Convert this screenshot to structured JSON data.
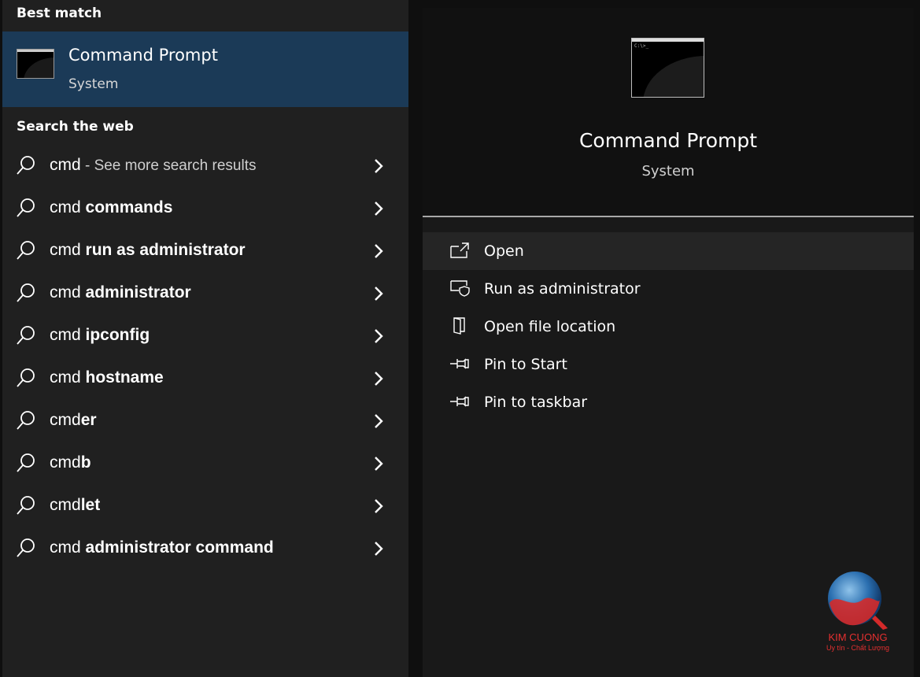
{
  "left": {
    "best_match_heading": "Best match",
    "best_match": {
      "title": "Command Prompt",
      "subtitle": "System",
      "icon": "cmd-window-icon"
    },
    "web_heading": "Search the web",
    "results": [
      {
        "query": "cmd",
        "suffix": "",
        "more": " - See more search results"
      },
      {
        "query": "cmd ",
        "suffix": "commands",
        "more": ""
      },
      {
        "query": "cmd ",
        "suffix": "run as administrator",
        "more": ""
      },
      {
        "query": "cmd ",
        "suffix": "administrator",
        "more": ""
      },
      {
        "query": "cmd ",
        "suffix": "ipconfig",
        "more": ""
      },
      {
        "query": "cmd ",
        "suffix": "hostname",
        "more": ""
      },
      {
        "query": "cmd",
        "suffix": "er",
        "more": ""
      },
      {
        "query": "cmd",
        "suffix": "b",
        "more": ""
      },
      {
        "query": "cmd",
        "suffix": "let",
        "more": ""
      },
      {
        "query": "cmd ",
        "suffix": "administrator command",
        "more": ""
      }
    ]
  },
  "right": {
    "app_title": "Command Prompt",
    "app_subtitle": "System",
    "icon_prompt": "C:\\>_",
    "actions": [
      {
        "label": "Open",
        "icon": "open-external-icon"
      },
      {
        "label": "Run as administrator",
        "icon": "shield-admin-icon"
      },
      {
        "label": "Open file location",
        "icon": "file-location-icon"
      },
      {
        "label": "Pin to Start",
        "icon": "pin-icon"
      },
      {
        "label": "Pin to taskbar",
        "icon": "pin-icon"
      }
    ]
  },
  "watermark": {
    "line1": "KIM CUONG",
    "line2": "Uy tín - Chất Lượng"
  },
  "colors": {
    "selected_bg": "#1b3a57",
    "panel_bg": "#202020",
    "hover_bg": "#252525",
    "brand_red": "#e53030"
  }
}
